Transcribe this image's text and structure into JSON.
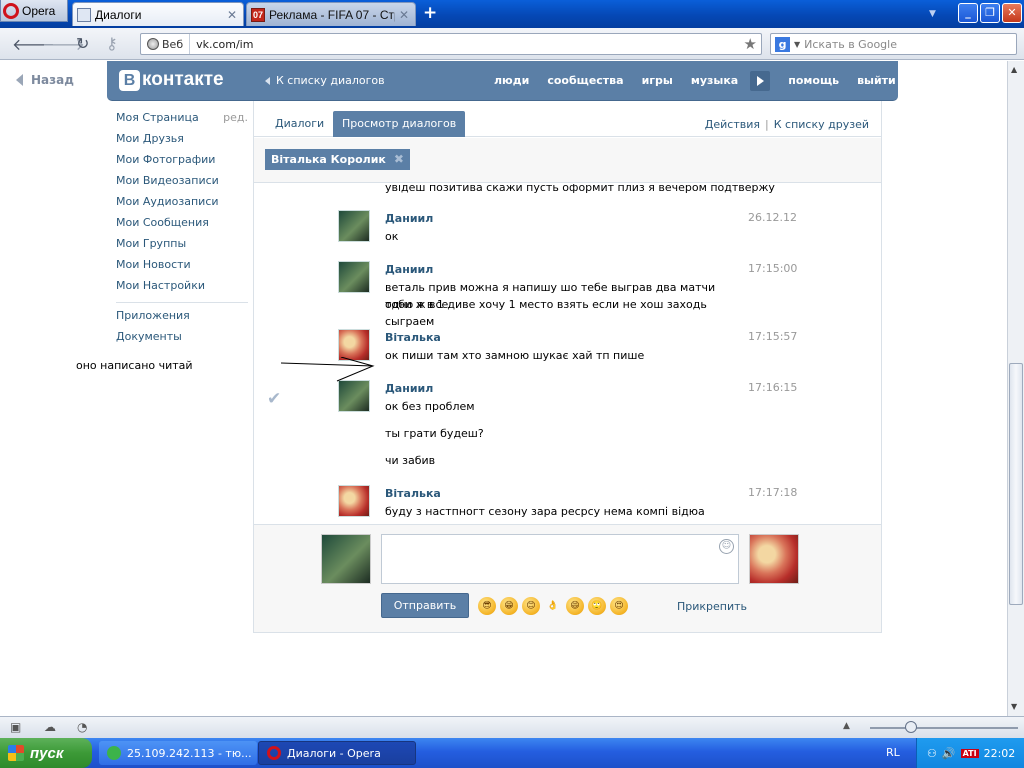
{
  "browser": {
    "opera_label": "Opera",
    "tabs": [
      {
        "title": "Диалоги"
      },
      {
        "title": "Реклама - FIFA 07 - Стр..."
      }
    ],
    "address": {
      "zone_label": "Веб",
      "url": "vk.com/im"
    },
    "search_placeholder": "Искать в Google"
  },
  "vk": {
    "back_label": "Назад",
    "logo_text": "контакте",
    "logo_letter": "В",
    "to_dialogs_label": "К списку диалогов",
    "top_nav": [
      "люди",
      "сообщества",
      "игры",
      "музыка",
      "помощь",
      "выйти"
    ],
    "left_menu": [
      {
        "label": "Моя Страница",
        "edit": "ред."
      },
      {
        "label": "Мои Друзья"
      },
      {
        "label": "Мои Фотографии"
      },
      {
        "label": "Мои Видеозаписи"
      },
      {
        "label": "Мои Аудиозаписи"
      },
      {
        "label": "Мои Сообщения"
      },
      {
        "label": "Мои Группы"
      },
      {
        "label": "Мои Новости"
      },
      {
        "label": "Мои Настройки"
      }
    ],
    "left_menu_extra": [
      "Приложения",
      "Документы"
    ],
    "status_text": "оно написано читай",
    "panel_tabs": [
      "Диалоги",
      "Просмотр диалогов"
    ],
    "actions_label": "Действия",
    "friends_list_label": "К списку друзей",
    "chip_name": "Віталька Королик",
    "partial_line": "увідеш позитива скажи пусть оформит плиз я вечером подтвержу",
    "messages": [
      {
        "author": "Даниил",
        "time": "26.12.12",
        "lines": [
          "ок"
        ]
      },
      {
        "author": "Даниил",
        "time": "17:15:00",
        "lines": [
          "веталь прив можна я напишу шо тебе выграв два матчи тоби ж все",
          "одно я в 1 диве хочу 1 место взять если не хош заходь сыграем"
        ]
      },
      {
        "author": "Віталька",
        "time": "17:15:57",
        "lines": [
          "ок пиши там хто замною шукає хай тп пише"
        ]
      },
      {
        "author": "Даниил",
        "time": "17:16:15",
        "lines": [
          "ок без проблем",
          "ты грати будеш?",
          "чи забив"
        ]
      },
      {
        "author": "Віталька",
        "time": "17:17:18",
        "lines": [
          "буду з настпногт сезону зара ресрсу нема компі відюа згоила"
        ]
      }
    ],
    "composer": {
      "send_label": "Отправить",
      "attach_label": "Прикрепить"
    }
  },
  "taskbar": {
    "start_label": "пуск",
    "items": [
      {
        "label": "25.109.242.113 - тю..."
      },
      {
        "label": "Диалоги - Opera"
      }
    ],
    "lang": "RL",
    "clock": "22:02"
  },
  "colors": {
    "vk_blue": "#5b7fa6",
    "link": "#2b587a",
    "xp_blue": "#245ee0"
  }
}
